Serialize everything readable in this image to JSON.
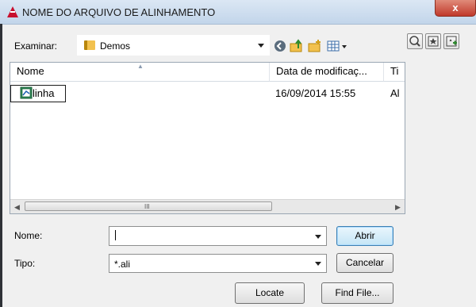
{
  "window": {
    "title": "NOME DO ARQUIVO DE ALINHAMENTO",
    "close_label": "x"
  },
  "toolbar": {
    "look_in_label": "Examinar:",
    "look_in_value": "Demos",
    "icons": [
      "back-icon",
      "up-folder-icon",
      "new-folder-icon",
      "view-menu-icon"
    ],
    "side_icons": [
      "search-web-icon",
      "favorites-icon",
      "add-favorite-icon"
    ]
  },
  "file_list": {
    "columns": [
      "Nome",
      "Data de modificaç...",
      "Ti"
    ],
    "rows": [
      {
        "name": "linha",
        "date": "16/09/2014 15:55",
        "type": "Al"
      }
    ],
    "scroll_grip": "III"
  },
  "form": {
    "name_label": "Nome:",
    "name_value": "",
    "type_label": "Tipo:",
    "type_value": "*.ali"
  },
  "buttons": {
    "open": "Abrir",
    "cancel": "Cancelar",
    "locate": "Locate",
    "find_file": "Find File..."
  },
  "colors": {
    "title_accent": "#c8102e",
    "close_button": "#c0392b",
    "default_button_border": "#3c7fb1"
  }
}
